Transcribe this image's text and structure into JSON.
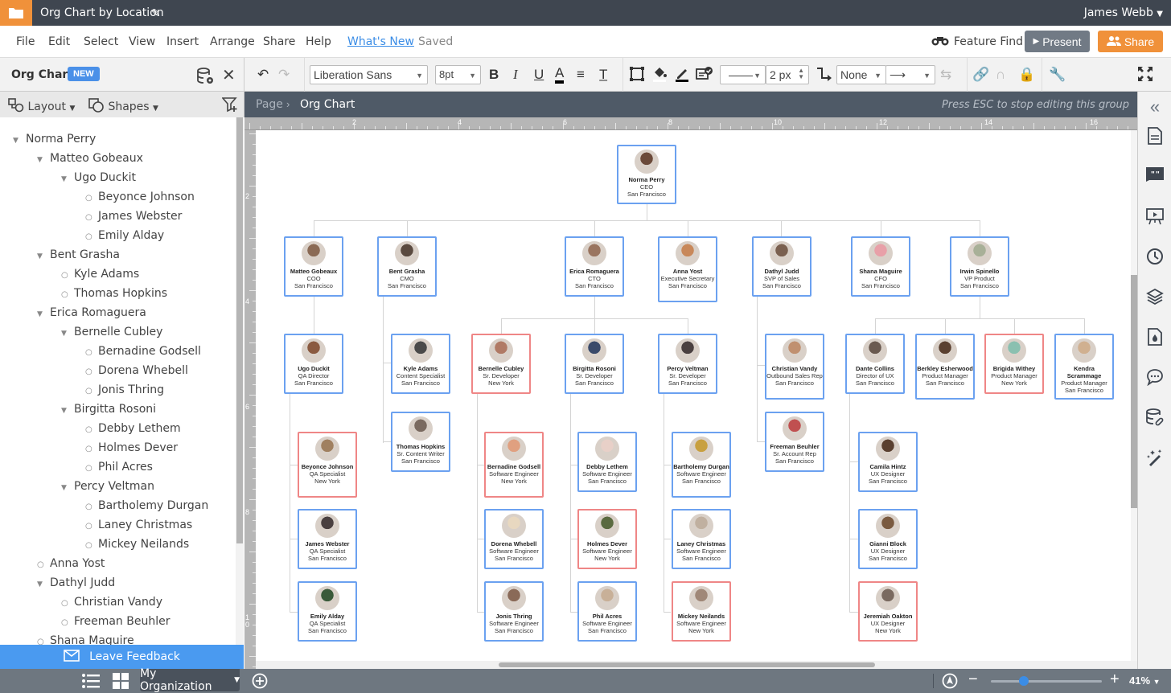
{
  "app": {
    "doc_title": "Org Chart by Location",
    "user_name": "James Webb",
    "icons": {
      "folder": "folder-icon",
      "pencil": "pencil-icon",
      "user_menu": "caret-down-icon"
    }
  },
  "menu": {
    "items": [
      "File",
      "Edit",
      "Select",
      "View",
      "Insert",
      "Arrange",
      "Share",
      "Help"
    ],
    "whats_new": "What's New",
    "status": "Saved",
    "feature_find": "Feature Find",
    "present": "Present",
    "share": "Share"
  },
  "left_panel": {
    "title": "Org Chart",
    "badge": "NEW",
    "layout_label": "Layout",
    "shapes_label": "Shapes",
    "feedback": "Leave Feedback",
    "tree": [
      {
        "label": "Norma Perry",
        "level": 0,
        "expanded": true
      },
      {
        "label": "Matteo Gobeaux",
        "level": 1,
        "expanded": true
      },
      {
        "label": "Ugo Duckit",
        "level": 2,
        "expanded": true
      },
      {
        "label": "Beyonce Johnson",
        "level": 3,
        "leaf": true
      },
      {
        "label": "James Webster",
        "level": 3,
        "leaf": true
      },
      {
        "label": "Emily Alday",
        "level": 3,
        "leaf": true
      },
      {
        "label": "Bent Grasha",
        "level": 1,
        "expanded": true
      },
      {
        "label": "Kyle Adams",
        "level": 2,
        "leaf": true
      },
      {
        "label": "Thomas Hopkins",
        "level": 2,
        "leaf": true
      },
      {
        "label": "Erica Romaguera",
        "level": 1,
        "expanded": true
      },
      {
        "label": "Bernelle Cubley",
        "level": 2,
        "expanded": true
      },
      {
        "label": "Bernadine Godsell",
        "level": 3,
        "leaf": true
      },
      {
        "label": "Dorena Whebell",
        "level": 3,
        "leaf": true
      },
      {
        "label": "Jonis Thring",
        "level": 3,
        "leaf": true
      },
      {
        "label": "Birgitta Rosoni",
        "level": 2,
        "expanded": true
      },
      {
        "label": "Debby Lethem",
        "level": 3,
        "leaf": true
      },
      {
        "label": "Holmes Dever",
        "level": 3,
        "leaf": true
      },
      {
        "label": "Phil Acres",
        "level": 3,
        "leaf": true
      },
      {
        "label": "Percy Veltman",
        "level": 2,
        "expanded": true
      },
      {
        "label": "Bartholemy Durgan",
        "level": 3,
        "leaf": true
      },
      {
        "label": "Laney Christmas",
        "level": 3,
        "leaf": true
      },
      {
        "label": "Mickey Neilands",
        "level": 3,
        "leaf": true
      },
      {
        "label": "Anna Yost",
        "level": 1,
        "leaf": true
      },
      {
        "label": "Dathyl Judd",
        "level": 1,
        "expanded": true
      },
      {
        "label": "Christian Vandy",
        "level": 2,
        "leaf": true
      },
      {
        "label": "Freeman Beuhler",
        "level": 2,
        "leaf": true
      },
      {
        "label": "Shana Maguire",
        "level": 1,
        "leaf": true
      }
    ]
  },
  "toolbar": {
    "font": "Liberation Sans",
    "font_size": "8pt",
    "line_width": "2 px",
    "arrow_start": "None"
  },
  "breadcrumb": {
    "page": "Page",
    "current": "Org Chart",
    "hint": "Press ESC to stop editing this group"
  },
  "rulers": {
    "top": [
      "2",
      "4",
      "6",
      "8",
      "10",
      "12",
      "14",
      "16"
    ],
    "left": [
      "2",
      "4",
      "6",
      "8",
      "10"
    ]
  },
  "bottom": {
    "org_selector": "My Organization",
    "zoom": "41%",
    "zoom_fraction": 0.3
  },
  "colors": {
    "san_francisco_border": "#6ba1f0",
    "new_york_border": "#ef8686",
    "accent_orange": "#f0913a",
    "accent_blue": "#4a9af0"
  },
  "org_chart": [
    {
      "name": "Norma Perry",
      "title": "CEO",
      "location": "San Francisco"
    },
    {
      "name": "Matteo Gobeaux",
      "title": "COO",
      "location": "San Francisco"
    },
    {
      "name": "Bent Grasha",
      "title": "CMO",
      "location": "San Francisco"
    },
    {
      "name": "Erica Romaguera",
      "title": "CTO",
      "location": "San Francisco"
    },
    {
      "name": "Anna Yost",
      "title": "Executive Secretary",
      "location": "San Francisco"
    },
    {
      "name": "Dathyl Judd",
      "title": "SVP of Sales",
      "location": "San Francisco"
    },
    {
      "name": "Shana Maguire",
      "title": "CFO",
      "location": "San Francisco"
    },
    {
      "name": "Irwin Spinello",
      "title": "VP Product",
      "location": "San Francisco"
    },
    {
      "name": "Ugo Duckit",
      "title": "QA Director",
      "location": "San Francisco"
    },
    {
      "name": "Kyle Adams",
      "title": "Content Specialist",
      "location": "San Francisco"
    },
    {
      "name": "Bernelle Cubley",
      "title": "Sr. Developer",
      "location": "New York"
    },
    {
      "name": "Birgitta Rosoni",
      "title": "Sr. Developer",
      "location": "San Francisco"
    },
    {
      "name": "Percy Veltman",
      "title": "Sr. Developer",
      "location": "San Francisco"
    },
    {
      "name": "Christian Vandy",
      "title": "Outbound Sales Rep",
      "location": "San Francisco"
    },
    {
      "name": "Dante Collins",
      "title": "Director of UX",
      "location": "San Francisco"
    },
    {
      "name": "Berkley Esherwood",
      "title": "Product Manager",
      "location": "San Francisco"
    },
    {
      "name": "Brigida Withey",
      "title": "Product Manager",
      "location": "New York"
    },
    {
      "name": "Kendra Scrammage",
      "title": "Product Manager",
      "location": "San Francisco"
    },
    {
      "name": "Thomas Hopkins",
      "title": "Sr. Content Writer",
      "location": "San Francisco"
    },
    {
      "name": "Freeman Beuhler",
      "title": "Sr. Account Rep",
      "location": "San Francisco"
    },
    {
      "name": "Beyonce Johnson",
      "title": "QA Specialist",
      "location": "New York"
    },
    {
      "name": "Bernadine Godsell",
      "title": "Software Engineer",
      "location": "New York"
    },
    {
      "name": "Debby Lethem",
      "title": "Software Engineer",
      "location": "San Francisco"
    },
    {
      "name": "Bartholemy Durgan",
      "title": "Software Engineer",
      "location": "San Francisco"
    },
    {
      "name": "Camila Hintz",
      "title": "UX Designer",
      "location": "San Francisco"
    },
    {
      "name": "James Webster",
      "title": "QA Specialist",
      "location": "San Francisco"
    },
    {
      "name": "Dorena Whebell",
      "title": "Software Engineer",
      "location": "San Francisco"
    },
    {
      "name": "Holmes Dever",
      "title": "Software Engineer",
      "location": "New York"
    },
    {
      "name": "Laney Christmas",
      "title": "Software Engineer",
      "location": "San Francisco"
    },
    {
      "name": "Gianni Block",
      "title": "UX Designer",
      "location": "San Francisco"
    },
    {
      "name": "Emily Alday",
      "title": "QA Specialist",
      "location": "San Francisco"
    },
    {
      "name": "Jonis Thring",
      "title": "Software Engineer",
      "location": "San Francisco"
    },
    {
      "name": "Phil Acres",
      "title": "Software Engineer",
      "location": "San Francisco"
    },
    {
      "name": "Mickey Neilands",
      "title": "Software Engineer",
      "location": "New York"
    },
    {
      "name": "Jeremiah Oakton",
      "title": "UX Designer",
      "location": "New York"
    }
  ]
}
